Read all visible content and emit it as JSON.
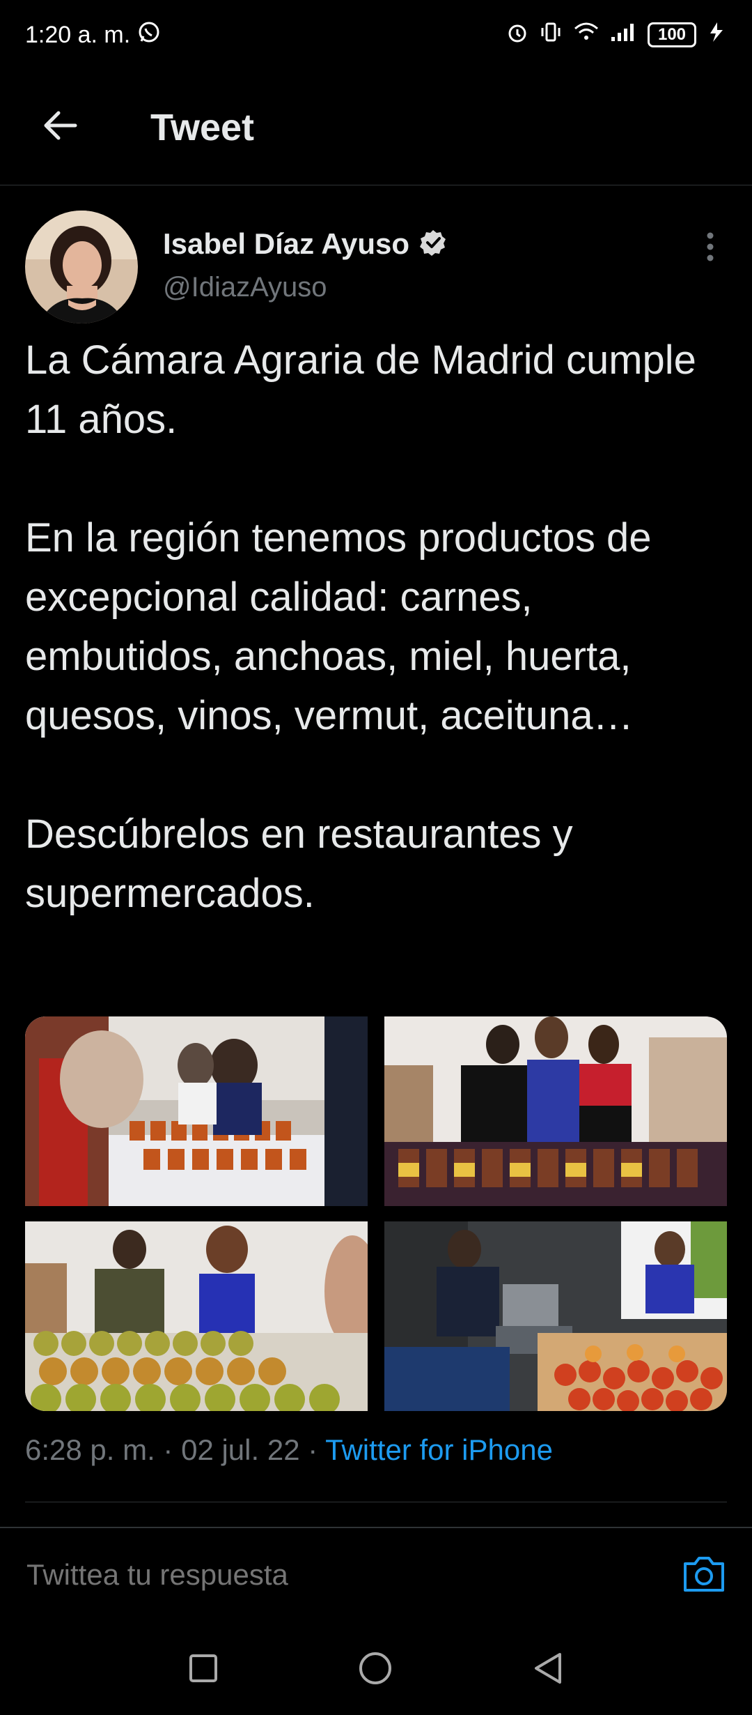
{
  "status_bar": {
    "time": "1:20 a. m.",
    "battery": "100",
    "icons": [
      "whatsapp-icon",
      "alarm-icon",
      "vibrate-icon",
      "wifi-icon",
      "signal-icon",
      "battery-icon",
      "charging-icon"
    ]
  },
  "header": {
    "title": "Tweet",
    "back_icon": "arrow-left-icon"
  },
  "tweet": {
    "author": {
      "name": "Isabel Díaz Ayuso",
      "handle": "@IdiazAyuso",
      "verified": true
    },
    "text": "La Cámara Agraria de Madrid cumple 11 años.\n\nEn la región tenemos productos de excepcional calidad: carnes, embutidos, anchoas, miel, huerta, quesos, vinos, vermut, aceituna…\n\nDescúbrelos en restaurantes y supermercados.",
    "media": [
      "photo-1",
      "photo-2",
      "photo-3",
      "photo-4"
    ],
    "time": "6:28 p. m. · 02 jul. 22 · ",
    "source": "Twitter for iPhone"
  },
  "reply": {
    "placeholder": "Twittea tu respuesta"
  },
  "colors": {
    "background": "#000000",
    "text": "#e7e9ea",
    "muted": "#71767b",
    "accent": "#1d9bf0",
    "divider": "#2f3336"
  }
}
